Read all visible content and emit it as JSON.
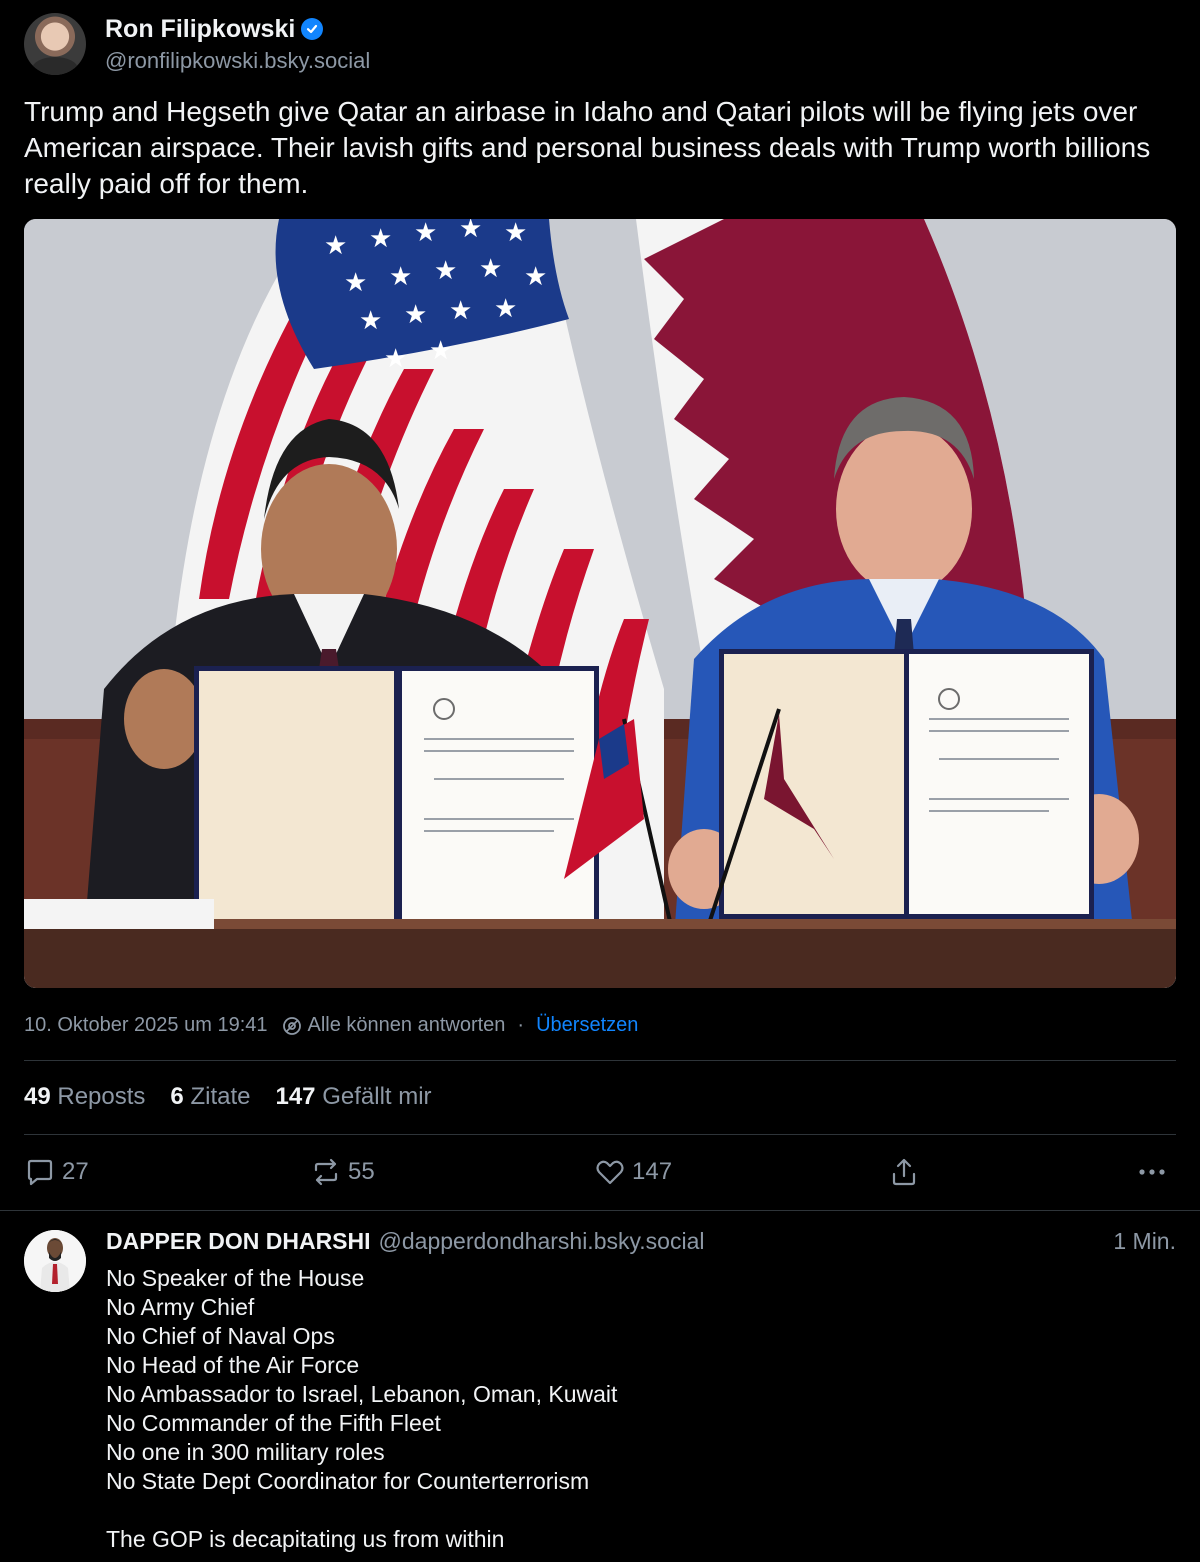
{
  "post": {
    "author": {
      "display_name": "Ron Filipkowski",
      "handle": "@ronfilipkowski.bsky.social",
      "avatar_icon": "profile-photo",
      "verified_icon": "verified-check-icon"
    },
    "text": "Trump and Hegseth give Qatar an airbase in Idaho and Qatari pilots will be flying jets over American airspace. Their lavish gifts and personal business deals with Trump worth billions really paid off for them.",
    "meta": {
      "timestamp": "10. Oktober 2025 um 19:41",
      "reply_setting": "Alle können antworten",
      "separator": "·",
      "translate": "Übersetzen"
    },
    "stats": {
      "reposts_count": "49",
      "reposts_label": "Reposts",
      "quotes_count": "6",
      "quotes_label": "Zitate",
      "likes_count": "147",
      "likes_label": "Gefällt mir"
    },
    "actions": {
      "replies": "27",
      "reposts": "55",
      "likes": "147"
    }
  },
  "reply": {
    "display_name": "DAPPER DON DHARSHI",
    "handle": "@dapperdondharshi.bsky.social",
    "time": "1 Min.",
    "lines": [
      "No Speaker of the House",
      "No Army Chief",
      "No Chief of Naval Ops",
      "No Head of the Air Force",
      "No Ambassador to Israel, Lebanon, Oman, Kuwait",
      "No Commander of the Fifth Fleet",
      "No one in 300 military roles",
      "No State Dept Coordinator for Counterterrorism",
      "",
      "The GOP is decapitating us from within"
    ]
  },
  "colors": {
    "background": "#000000",
    "text": "#f1f3f5",
    "muted": "#8d98a5",
    "accent": "#1185fe",
    "divider": "#2e3439",
    "qatar_maroon": "#8a1538"
  }
}
